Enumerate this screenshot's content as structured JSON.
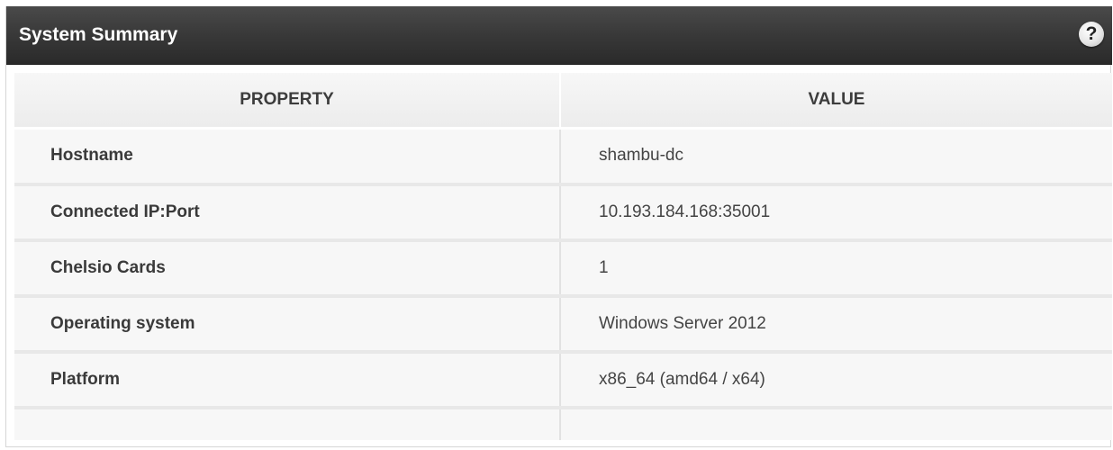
{
  "panel": {
    "title": "System Summary",
    "help_label": "?"
  },
  "table": {
    "headers": [
      "PROPERTY",
      "VALUE"
    ],
    "rows": [
      {
        "property": "Hostname",
        "value": "shambu-dc"
      },
      {
        "property": "Connected IP:Port",
        "value": "10.193.184.168:35001"
      },
      {
        "property": "Chelsio Cards",
        "value": "1"
      },
      {
        "property": "Operating system",
        "value": "Windows Server 2012"
      },
      {
        "property": "Platform",
        "value": "x86_64 (amd64 / x64)"
      }
    ]
  }
}
